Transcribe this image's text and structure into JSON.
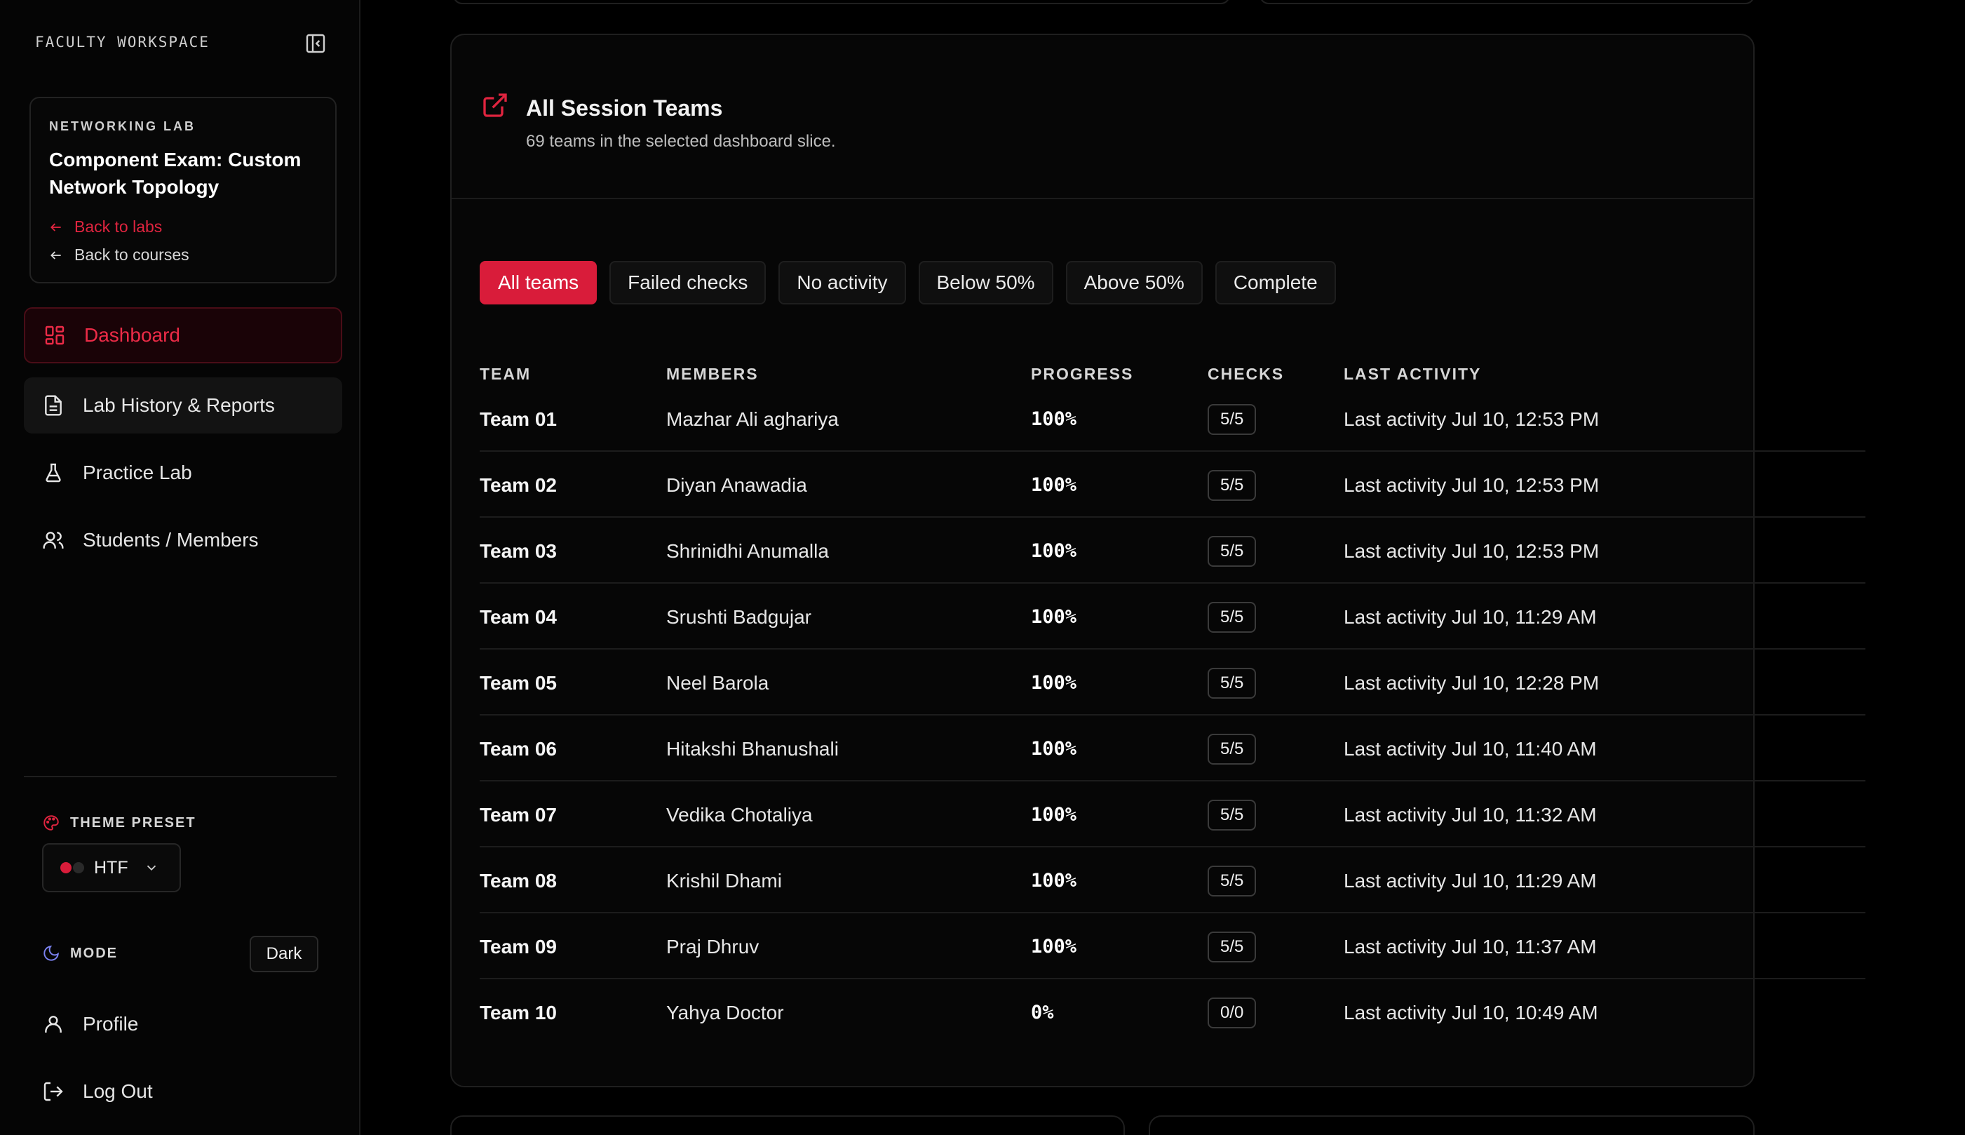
{
  "sidebar": {
    "workspace_title": "FACULTY WORKSPACE",
    "lab_card": {
      "kicker": "NETWORKING LAB",
      "name": "Component Exam: Custom Network Topology",
      "back_to_labs": "Back to labs",
      "back_to_courses": "Back to courses"
    },
    "nav": {
      "dashboard": "Dashboard",
      "history": "Lab History & Reports",
      "practice": "Practice Lab",
      "students": "Students / Members"
    },
    "theme": {
      "label": "THEME PRESET",
      "value": "HTF"
    },
    "mode": {
      "label": "MODE",
      "value": "Dark"
    },
    "profile": "Profile",
    "logout": "Log Out"
  },
  "colors": {
    "accent": "#d91c3a",
    "background": "#000000",
    "panel": "#060606"
  },
  "panel": {
    "title": "All Session Teams",
    "subtitle": "69 teams in the selected dashboard slice.",
    "filters": [
      "All teams",
      "Failed checks",
      "No activity",
      "Below 50%",
      "Above 50%",
      "Complete"
    ],
    "active_filter": "All teams",
    "columns": [
      "TEAM",
      "MEMBERS",
      "PROGRESS",
      "CHECKS",
      "LAST ACTIVITY"
    ],
    "rows": [
      {
        "team": "Team 01",
        "members": "Mazhar Ali aghariya",
        "progress": "100%",
        "checks": "5/5",
        "activity": "Last activity Jul 10, 12:53 PM"
      },
      {
        "team": "Team 02",
        "members": "Diyan Anawadia",
        "progress": "100%",
        "checks": "5/5",
        "activity": "Last activity Jul 10, 12:53 PM"
      },
      {
        "team": "Team 03",
        "members": "Shrinidhi Anumalla",
        "progress": "100%",
        "checks": "5/5",
        "activity": "Last activity Jul 10, 12:53 PM"
      },
      {
        "team": "Team 04",
        "members": "Srushti Badgujar",
        "progress": "100%",
        "checks": "5/5",
        "activity": "Last activity Jul 10, 11:29 AM"
      },
      {
        "team": "Team 05",
        "members": "Neel Barola",
        "progress": "100%",
        "checks": "5/5",
        "activity": "Last activity Jul 10, 12:28 PM"
      },
      {
        "team": "Team 06",
        "members": "Hitakshi Bhanushali",
        "progress": "100%",
        "checks": "5/5",
        "activity": "Last activity Jul 10, 11:40 AM"
      },
      {
        "team": "Team 07",
        "members": "Vedika Chotaliya",
        "progress": "100%",
        "checks": "5/5",
        "activity": "Last activity Jul 10, 11:32 AM"
      },
      {
        "team": "Team 08",
        "members": "Krishil Dhami",
        "progress": "100%",
        "checks": "5/5",
        "activity": "Last activity Jul 10, 11:29 AM"
      },
      {
        "team": "Team 09",
        "members": "Praj Dhruv",
        "progress": "100%",
        "checks": "5/5",
        "activity": "Last activity Jul 10, 11:37 AM"
      },
      {
        "team": "Team 10",
        "members": "Yahya Doctor",
        "progress": "0%",
        "checks": "0/0",
        "activity": "Last activity Jul 10, 10:49 AM"
      }
    ]
  }
}
